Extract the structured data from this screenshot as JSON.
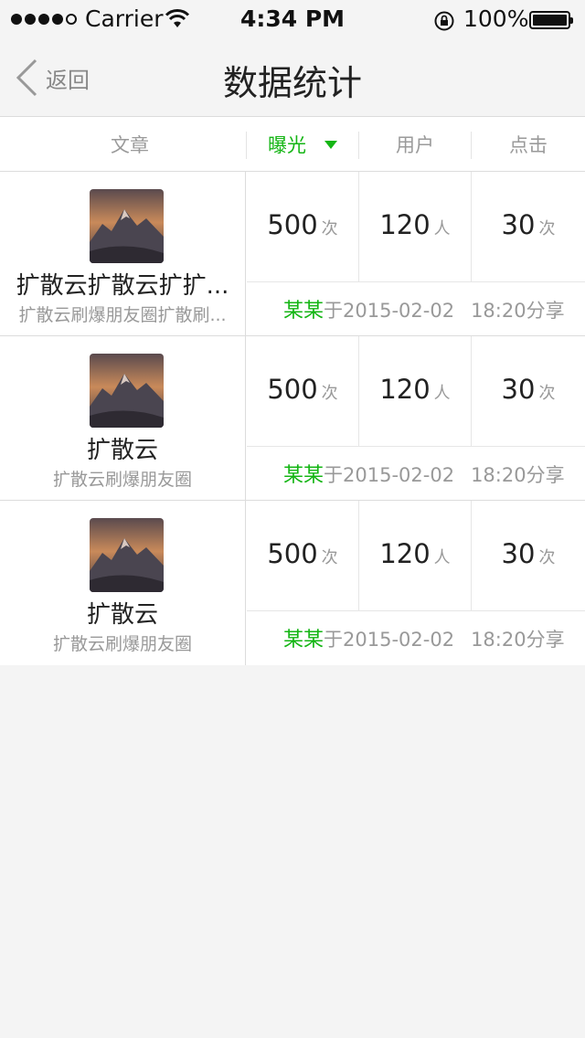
{
  "status_bar": {
    "carrier": "Carrier",
    "time": "4:34 PM",
    "battery": "100%"
  },
  "nav": {
    "back_label": "返回",
    "title": "数据统计"
  },
  "table": {
    "headers": [
      "文章",
      "曝光",
      "用户",
      "点击"
    ],
    "active_header": "曝光",
    "accent_color": "#14b514",
    "rows": [
      {
        "title": "扩散云扩散云扩扩...",
        "subtitle": "扩散云刷爆朋友圈扩散刷...",
        "exposure": "500",
        "exposure_unit": "次",
        "users": "120",
        "users_unit": "人",
        "clicks": "30",
        "clicks_unit": "次",
        "sharer": "某某",
        "share_date": "于2015-02-02",
        "share_time": "18:20分享"
      },
      {
        "title": "扩散云",
        "subtitle": "扩散云刷爆朋友圈",
        "exposure": "500",
        "exposure_unit": "次",
        "users": "120",
        "users_unit": "人",
        "clicks": "30",
        "clicks_unit": "次",
        "sharer": "某某",
        "share_date": "于2015-02-02",
        "share_time": "18:20分享"
      },
      {
        "title": "扩散云",
        "subtitle": "扩散云刷爆朋友圈",
        "exposure": "500",
        "exposure_unit": "次",
        "users": "120",
        "users_unit": "人",
        "clicks": "30",
        "clicks_unit": "次",
        "sharer": "某某",
        "share_date": "于2015-02-02",
        "share_time": "18:20分享"
      }
    ]
  }
}
